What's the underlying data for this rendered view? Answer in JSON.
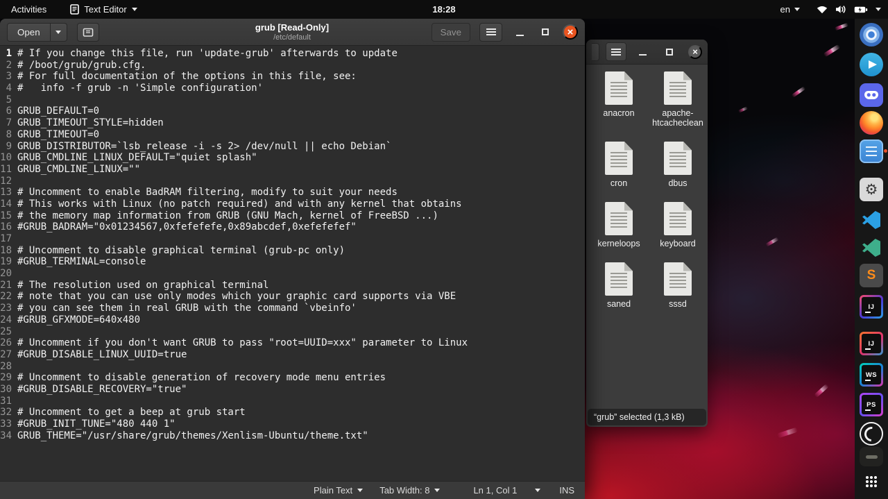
{
  "topbar": {
    "activities": "Activities",
    "app_menu": "Text Editor",
    "clock": "18:28",
    "keyboard_layout": "en"
  },
  "editor": {
    "open_label": "Open",
    "save_label": "Save",
    "title": "grub [Read-Only]",
    "subtitle": "/etc/default",
    "lines": [
      {
        "no": "1",
        "text": "# If you change this file, run 'update-grub' afterwards to update"
      },
      {
        "no": "2",
        "text": "# /boot/grub/grub.cfg."
      },
      {
        "no": "3",
        "text": "# For full documentation of the options in this file, see:"
      },
      {
        "no": "4",
        "text": "#   info -f grub -n 'Simple configuration'"
      },
      {
        "no": "5",
        "text": ""
      },
      {
        "no": "6",
        "text": "GRUB_DEFAULT=0"
      },
      {
        "no": "7",
        "text": "GRUB_TIMEOUT_STYLE=hidden"
      },
      {
        "no": "8",
        "text": "GRUB_TIMEOUT=0"
      },
      {
        "no": "9",
        "text": "GRUB_DISTRIBUTOR=`lsb_release -i -s 2> /dev/null || echo Debian`"
      },
      {
        "no": "10",
        "text": "GRUB_CMDLINE_LINUX_DEFAULT=\"quiet splash\""
      },
      {
        "no": "11",
        "text": "GRUB_CMDLINE_LINUX=\"\""
      },
      {
        "no": "12",
        "text": ""
      },
      {
        "no": "13",
        "text": "# Uncomment to enable BadRAM filtering, modify to suit your needs"
      },
      {
        "no": "14",
        "text": "# This works with Linux (no patch required) and with any kernel that obtains"
      },
      {
        "no": "15",
        "text": "# the memory map information from GRUB (GNU Mach, kernel of FreeBSD ...)"
      },
      {
        "no": "16",
        "text": "#GRUB_BADRAM=\"0x01234567,0xfefefefe,0x89abcdef,0xefefefef\""
      },
      {
        "no": "17",
        "text": ""
      },
      {
        "no": "18",
        "text": "# Uncomment to disable graphical terminal (grub-pc only)"
      },
      {
        "no": "19",
        "text": "#GRUB_TERMINAL=console"
      },
      {
        "no": "20",
        "text": ""
      },
      {
        "no": "21",
        "text": "# The resolution used on graphical terminal"
      },
      {
        "no": "22",
        "text": "# note that you can use only modes which your graphic card supports via VBE"
      },
      {
        "no": "23",
        "text": "# you can see them in real GRUB with the command `vbeinfo'"
      },
      {
        "no": "24",
        "text": "#GRUB_GFXMODE=640x480"
      },
      {
        "no": "25",
        "text": ""
      },
      {
        "no": "26",
        "text": "# Uncomment if you don't want GRUB to pass \"root=UUID=xxx\" parameter to Linux"
      },
      {
        "no": "27",
        "text": "#GRUB_DISABLE_LINUX_UUID=true"
      },
      {
        "no": "28",
        "text": ""
      },
      {
        "no": "29",
        "text": "# Uncomment to disable generation of recovery mode menu entries"
      },
      {
        "no": "30",
        "text": "#GRUB_DISABLE_RECOVERY=\"true\""
      },
      {
        "no": "31",
        "text": ""
      },
      {
        "no": "32",
        "text": "# Uncomment to get a beep at grub start"
      },
      {
        "no": "33",
        "text": "#GRUB_INIT_TUNE=\"480 440 1\""
      },
      {
        "no": "34",
        "text": "GRUB_THEME=\"/usr/share/grub/themes/Xenlism-Ubuntu/theme.txt\""
      }
    ],
    "status": {
      "language": "Plain Text",
      "tab_width": "Tab Width: 8",
      "cursor": "Ln 1, Col 1",
      "mode": "INS"
    }
  },
  "file_manager": {
    "items": [
      "anacron",
      "apache-htcacheclean",
      "cron",
      "dbus",
      "kerneloops",
      "keyboard",
      "saned",
      "sssd"
    ],
    "status": "“grub” selected (1,3 kB)"
  },
  "dock": {
    "items": [
      {
        "name": "dock-chromium",
        "icon": "chromium-icon",
        "glyph": ""
      },
      {
        "name": "dock-telegram",
        "icon": "telegram-icon",
        "glyph": ""
      },
      {
        "name": "dock-discord",
        "icon": "discord-icon",
        "glyph": ""
      },
      {
        "name": "dock-firefox",
        "icon": "firefox-icon",
        "glyph": ""
      },
      {
        "name": "dock-notes",
        "icon": "notes-icon",
        "glyph": ""
      },
      {
        "name": "dock-settings",
        "icon": "gear-icon",
        "glyph": "⚙"
      },
      {
        "name": "dock-vscode",
        "icon": "vscode-icon",
        "glyph": ""
      },
      {
        "name": "dock-vscodium",
        "icon": "vscodium-icon",
        "glyph": ""
      },
      {
        "name": "dock-sublime",
        "icon": "sublime-text-icon",
        "glyph": "S"
      },
      {
        "name": "dock-intellij",
        "icon": "intellij-idea-icon",
        "glyph": "IJ"
      },
      {
        "name": "dock-intellij-ce",
        "icon": "intellij-idea-ce-icon",
        "glyph": "IJ"
      },
      {
        "name": "dock-webstorm",
        "icon": "webstorm-icon",
        "glyph": "WS"
      },
      {
        "name": "dock-phpstorm",
        "icon": "phpstorm-icon",
        "glyph": "PS"
      },
      {
        "name": "dock-obs",
        "icon": "obs-studio-icon",
        "glyph": ""
      },
      {
        "name": "dock-dimmed-app",
        "icon": "dimmed-app-icon",
        "glyph": ""
      },
      {
        "name": "dock-show-apps",
        "icon": "show-applications-icon",
        "glyph": ""
      }
    ]
  },
  "colors": {
    "close_button": "#e95420",
    "dock_indicator": "#e8502a"
  }
}
